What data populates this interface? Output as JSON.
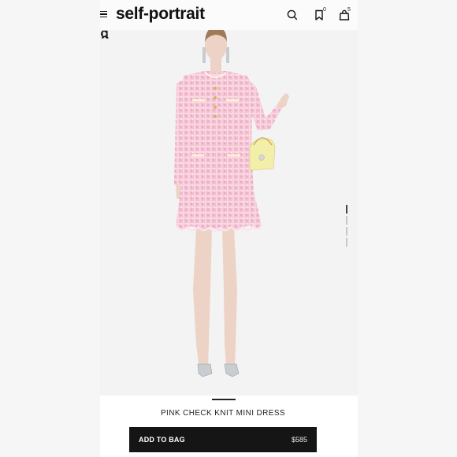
{
  "header": {
    "brand": "self-portrait",
    "wishlist_count": "0",
    "bag_count": "5"
  },
  "gallery": {
    "image_count": 4,
    "active_image": 1
  },
  "product": {
    "title": "PINK CHECK KNIT MINI DRESS",
    "add_to_bag_label": "ADD TO BAG",
    "price": "$585"
  },
  "colors": {
    "dress_pink": "#f2b8cc",
    "button_bg": "#151515",
    "bag_yellow": "#f4efa8"
  },
  "icons": [
    "menu-icon",
    "search-icon",
    "bookmark-icon",
    "bag-icon",
    "zoom-icon",
    "wishlist-icon"
  ]
}
